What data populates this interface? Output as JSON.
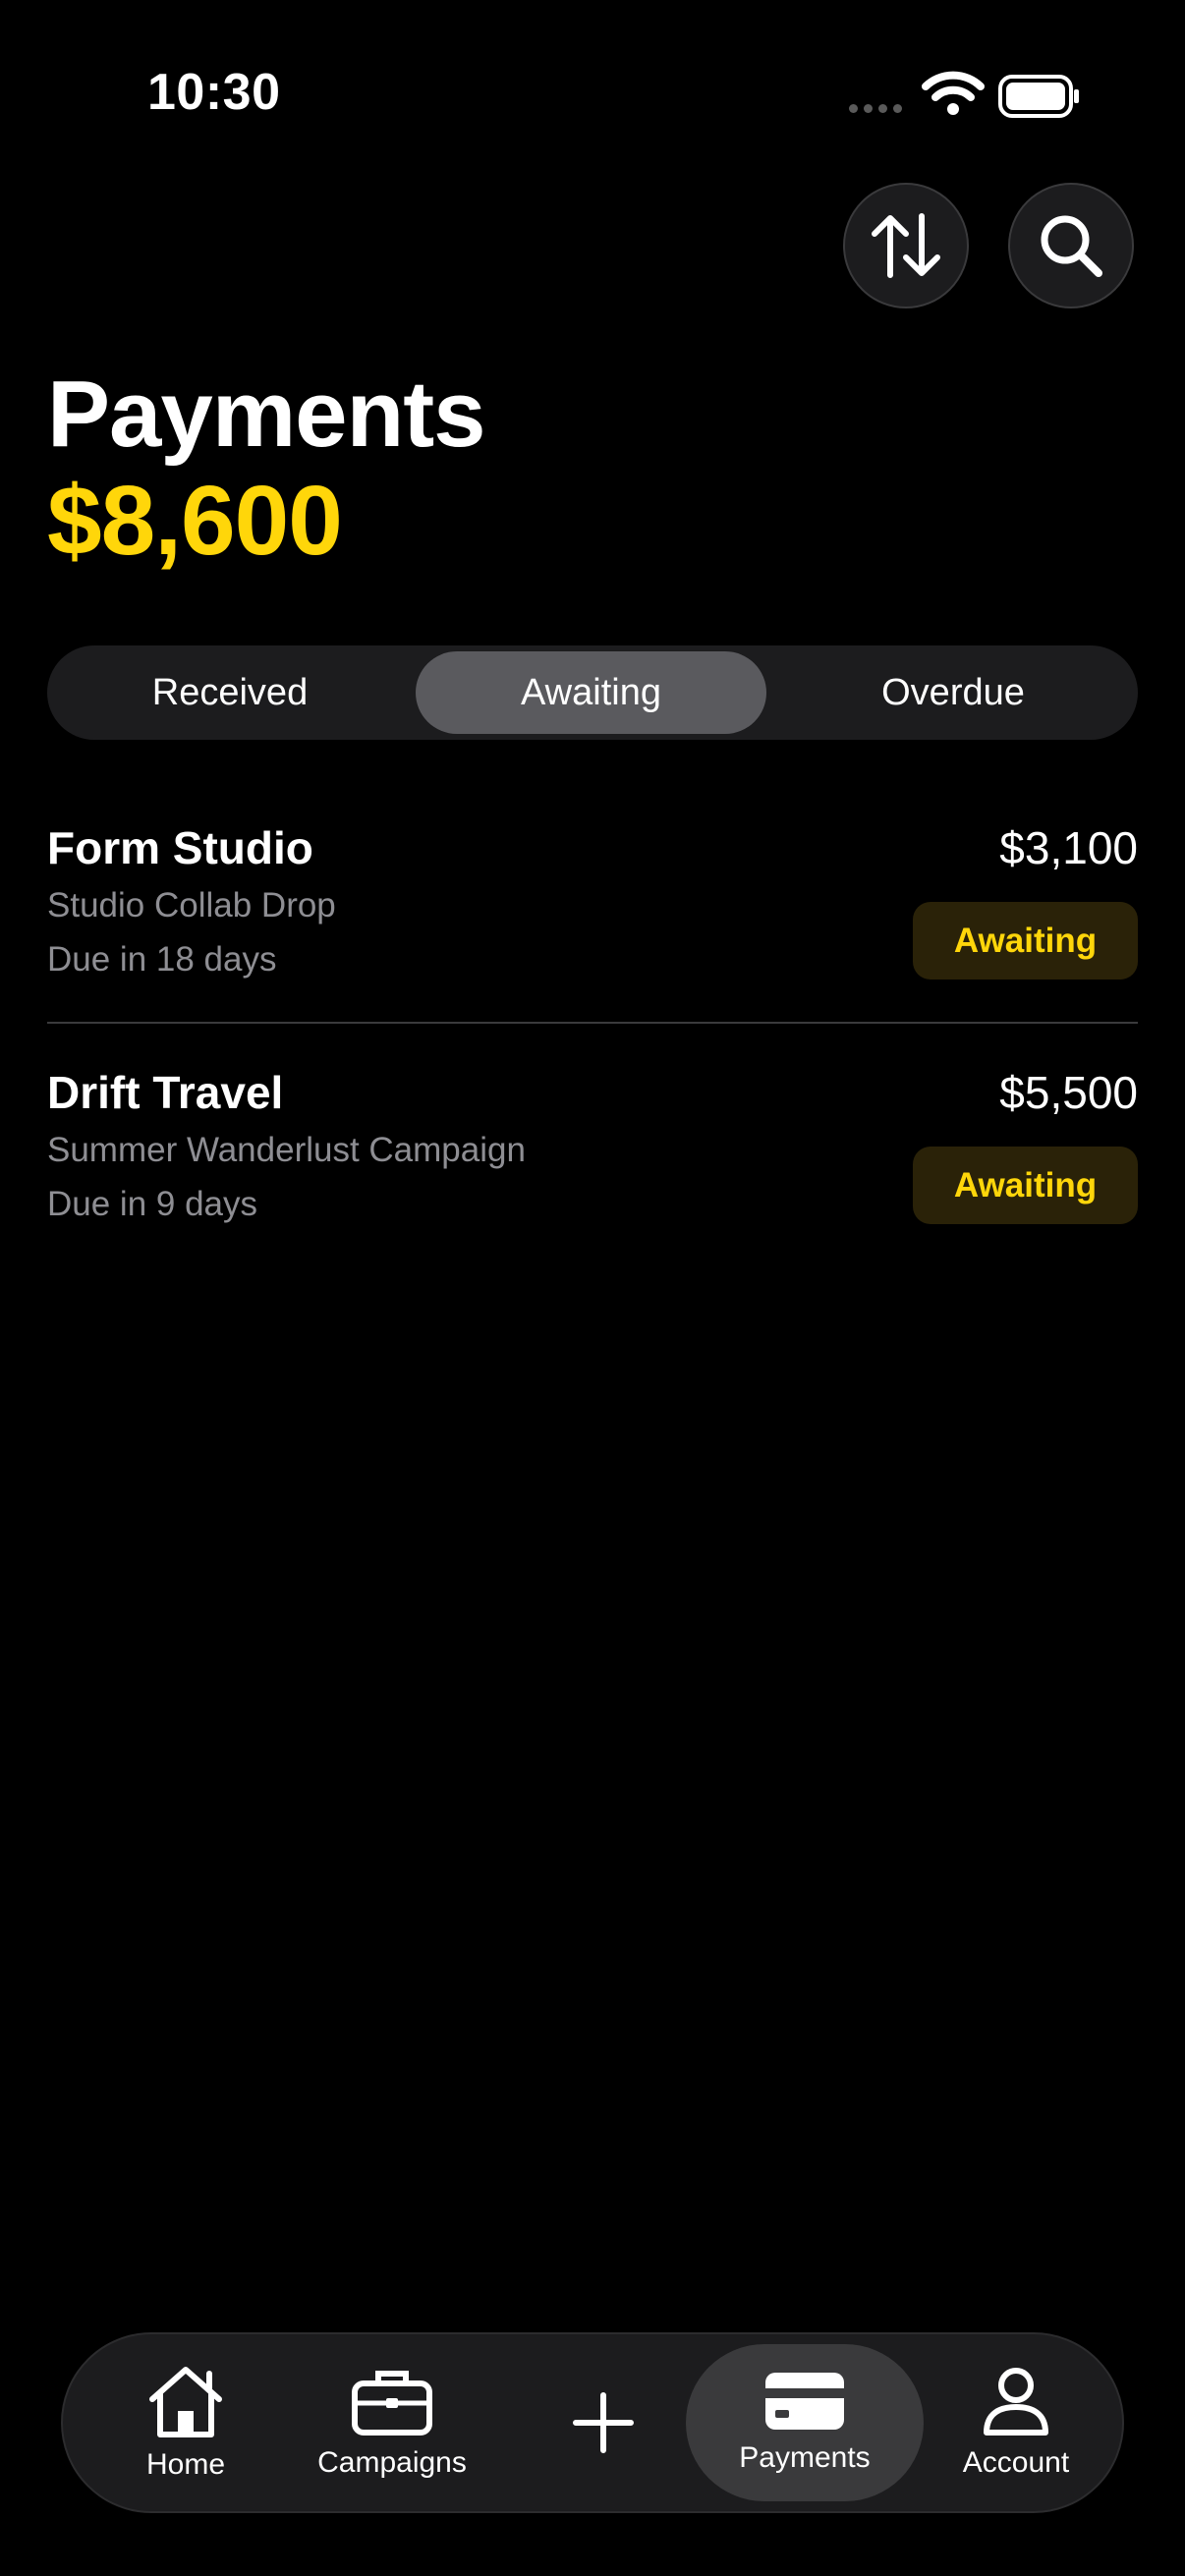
{
  "status_bar": {
    "time": "10:30"
  },
  "header": {
    "title": "Payments",
    "total": "$8,600"
  },
  "segments": [
    {
      "label": "Received",
      "selected": false
    },
    {
      "label": "Awaiting",
      "selected": true
    },
    {
      "label": "Overdue",
      "selected": false
    }
  ],
  "payments": [
    {
      "client": "Form Studio",
      "campaign": "Studio Collab Drop",
      "due": "Due in 18 days",
      "amount": "$3,100",
      "status": "Awaiting"
    },
    {
      "client": "Drift Travel",
      "campaign": "Summer Wanderlust Campaign",
      "due": "Due in 9 days",
      "amount": "$5,500",
      "status": "Awaiting"
    }
  ],
  "tabbar": {
    "items": [
      {
        "label": "Home",
        "icon": "house-icon"
      },
      {
        "label": "Campaigns",
        "icon": "briefcase-icon"
      },
      {
        "label": "",
        "icon": "plus-icon"
      },
      {
        "label": "Payments",
        "icon": "credit-card-icon",
        "selected": true
      },
      {
        "label": "Account",
        "icon": "person-icon"
      }
    ]
  },
  "colors": {
    "accent": "#FFD60A",
    "background": "#000000",
    "surface": "#1c1c1e",
    "badge_bg": "#2a2208"
  }
}
